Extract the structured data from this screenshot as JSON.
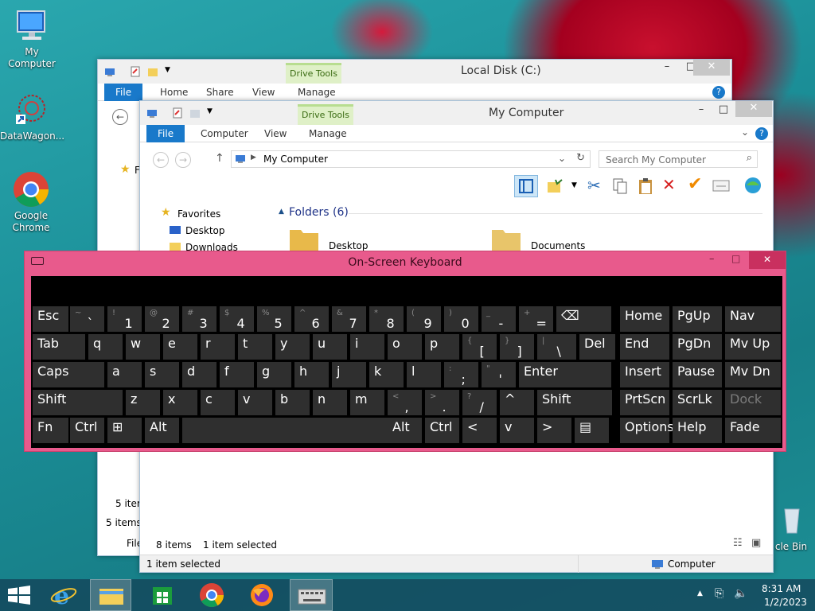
{
  "desktop": {
    "icons": [
      {
        "label": "My Computer",
        "icon": "computer-icon"
      },
      {
        "label": "DataWagon...",
        "icon": "datawagon-icon"
      },
      {
        "label": "Google Chrome",
        "icon": "chrome-icon"
      },
      {
        "label": "cle Bin",
        "icon": "recycle-bin-icon"
      }
    ]
  },
  "window_back": {
    "title": "Local Disk (C:)",
    "context_tab": "Drive Tools",
    "tabs": [
      "File",
      "Home",
      "Share",
      "View",
      "Manage"
    ],
    "nav_partial": "F",
    "status_items": "5 items",
    "status_partial_items": "5 item",
    "status_partial_file": "File"
  },
  "window_front": {
    "title": "My Computer",
    "context_tab": "Drive Tools",
    "tabs": [
      "File",
      "Computer",
      "View",
      "Manage"
    ],
    "address": "My Computer",
    "search_placeholder": "Search My Computer",
    "nav": [
      "Favorites",
      "Desktop",
      "Downloads"
    ],
    "folders_header": "Folders (6)",
    "folders": [
      "Desktop",
      "Documents"
    ],
    "status_count": "8 items",
    "status_selected": "1 item selected",
    "bottom_selected": "1 item selected",
    "bottom_location": "Computer"
  },
  "keyboard": {
    "title": "On-Screen Keyboard",
    "rows": [
      [
        {
          "t": "Esc"
        },
        {
          "s": "~",
          "m": "`"
        },
        {
          "s": "!",
          "m": "1"
        },
        {
          "s": "@",
          "m": "2"
        },
        {
          "s": "#",
          "m": "3"
        },
        {
          "s": "$",
          "m": "4"
        },
        {
          "s": "%",
          "m": "5"
        },
        {
          "s": "^",
          "m": "6"
        },
        {
          "s": "&",
          "m": "7"
        },
        {
          "s": "*",
          "m": "8"
        },
        {
          "s": "(",
          "m": "9"
        },
        {
          "s": ")",
          "m": "0"
        },
        {
          "s": "_",
          "m": "-"
        },
        {
          "s": "+",
          "m": "="
        },
        {
          "t": "⌫"
        },
        {
          "t": "Home"
        },
        {
          "t": "PgUp"
        },
        {
          "t": "Nav"
        }
      ],
      [
        {
          "t": "Tab"
        },
        {
          "t": "q"
        },
        {
          "t": "w"
        },
        {
          "t": "e"
        },
        {
          "t": "r"
        },
        {
          "t": "t"
        },
        {
          "t": "y"
        },
        {
          "t": "u"
        },
        {
          "t": "i"
        },
        {
          "t": "o"
        },
        {
          "t": "p"
        },
        {
          "s": "{",
          "m": "["
        },
        {
          "s": "}",
          "m": "]"
        },
        {
          "s": "|",
          "m": "\\"
        },
        {
          "t": "Del"
        },
        {
          "t": "End"
        },
        {
          "t": "PgDn"
        },
        {
          "t": "Mv Up"
        }
      ],
      [
        {
          "t": "Caps"
        },
        {
          "t": "a"
        },
        {
          "t": "s"
        },
        {
          "t": "d"
        },
        {
          "t": "f"
        },
        {
          "t": "g"
        },
        {
          "t": "h"
        },
        {
          "t": "j"
        },
        {
          "t": "k"
        },
        {
          "t": "l"
        },
        {
          "s": ":",
          "m": ";"
        },
        {
          "s": "\"",
          "m": "'"
        },
        {
          "t": "Enter"
        },
        {
          "t": "Insert"
        },
        {
          "t": "Pause"
        },
        {
          "t": "Mv Dn"
        }
      ],
      [
        {
          "t": "Shift"
        },
        {
          "t": "z"
        },
        {
          "t": "x"
        },
        {
          "t": "c"
        },
        {
          "t": "v"
        },
        {
          "t": "b"
        },
        {
          "t": "n"
        },
        {
          "t": "m"
        },
        {
          "s": "<",
          "m": ","
        },
        {
          "s": ">",
          "m": "."
        },
        {
          "s": "?",
          "m": "/"
        },
        {
          "t": "^"
        },
        {
          "t": "Shift"
        },
        {
          "t": "PrtScn"
        },
        {
          "t": "ScrLk"
        },
        {
          "t": "Dock"
        }
      ],
      [
        {
          "t": "Fn"
        },
        {
          "t": "Ctrl"
        },
        {
          "t": "⊞"
        },
        {
          "t": "Alt"
        },
        {
          "t": ""
        },
        {
          "t": "Alt"
        },
        {
          "t": "Ctrl"
        },
        {
          "t": "<"
        },
        {
          "t": "v"
        },
        {
          "t": ">"
        },
        {
          "t": "▤"
        },
        {
          "t": "Options"
        },
        {
          "t": "Help"
        },
        {
          "t": "Fade"
        }
      ]
    ]
  },
  "taskbar": {
    "time": "8:31 AM",
    "date": "1/2/2023",
    "apps": [
      "start-button",
      "internet-explorer-icon",
      "file-explorer-icon",
      "store-icon",
      "chrome-icon",
      "firefox-icon",
      "on-screen-keyboard-icon"
    ]
  }
}
